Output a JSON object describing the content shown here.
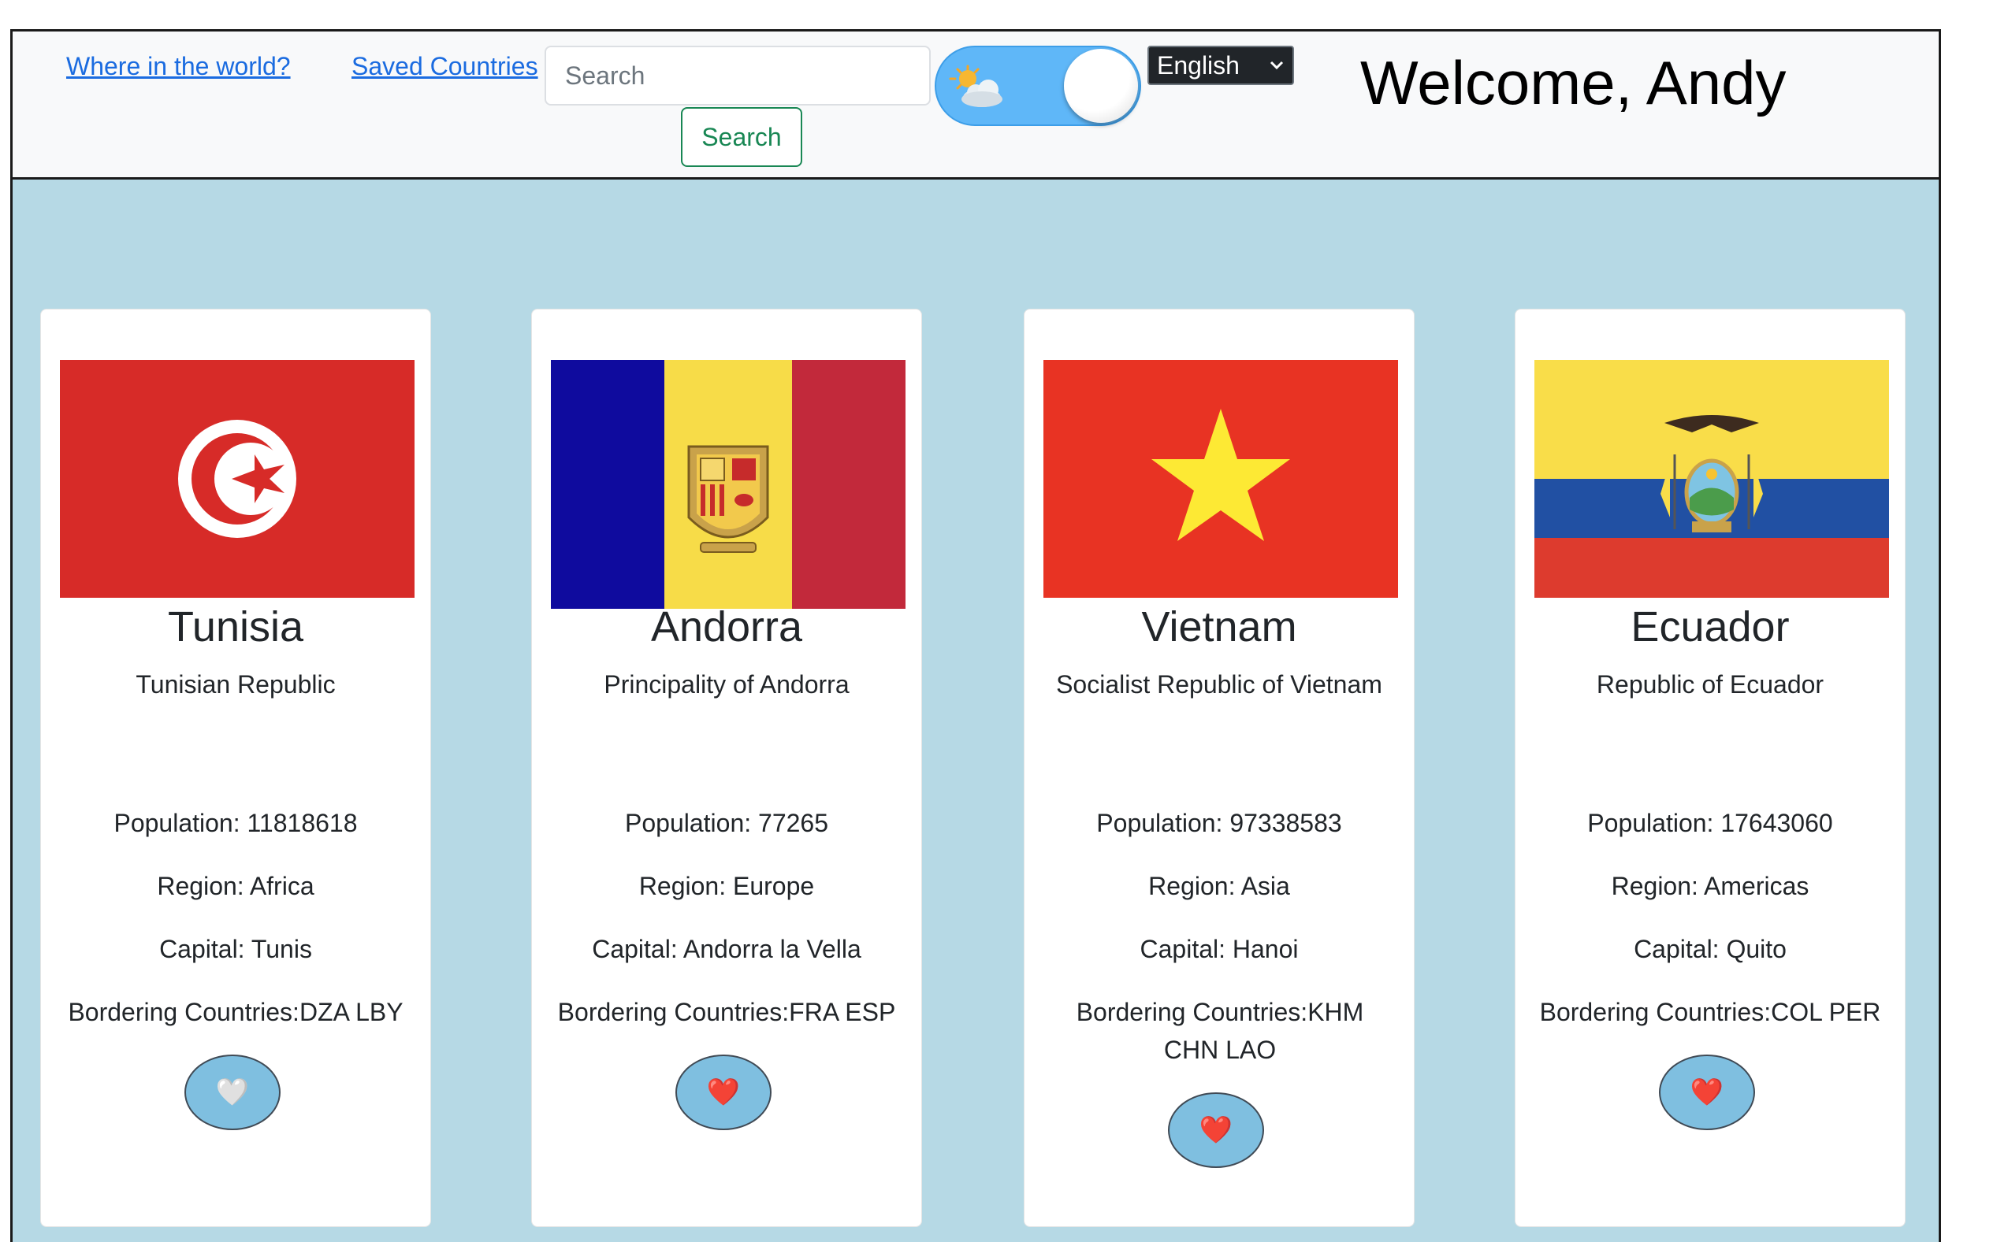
{
  "nav": {
    "link_home": "Where in the world?",
    "link_saved": "Saved Countries",
    "search_placeholder": "Search",
    "search_button": "Search",
    "language_selected": "English",
    "welcome_text": "Welcome, Andy",
    "theme_toggle_icon": "sun-behind-cloud-icon"
  },
  "colors": {
    "page_background": "#b6d9e5",
    "navbar_background": "#f8f9fa",
    "link": "#1a6be0",
    "search_button": "#198754",
    "toggle": "#5fb7f8",
    "heart_button": "#7fbfe0"
  },
  "cards": [
    {
      "name": "Tunisia",
      "official_name": "Tunisian Republic",
      "population": "Population: 11818618",
      "region": "Region: Africa",
      "capital": "Capital: Tunis",
      "borders": "Bordering Countries:DZA LBY",
      "flag": "tunisia-flag",
      "favorite_icon": "white-heart-icon",
      "favorite_glyph": "🤍"
    },
    {
      "name": "Andorra",
      "official_name": "Principality of Andorra",
      "population": "Population: 77265",
      "region": "Region: Europe",
      "capital": "Capital: Andorra la Vella",
      "borders": "Bordering Countries:FRA ESP",
      "flag": "andorra-flag",
      "favorite_icon": "red-heart-icon",
      "favorite_glyph": "❤️"
    },
    {
      "name": "Vietnam",
      "official_name": "Socialist Republic of Vietnam",
      "population": "Population: 97338583",
      "region": "Region: Asia",
      "capital": "Capital: Hanoi",
      "borders": "Bordering Countries:KHM CHN LAO",
      "flag": "vietnam-flag",
      "favorite_icon": "red-heart-icon",
      "favorite_glyph": "❤️"
    },
    {
      "name": "Ecuador",
      "official_name": "Republic of Ecuador",
      "population": "Population: 17643060",
      "region": "Region: Americas",
      "capital": "Capital: Quito",
      "borders": "Bordering Countries:COL PER",
      "flag": "ecuador-flag",
      "favorite_icon": "red-heart-icon",
      "favorite_glyph": "❤️"
    }
  ]
}
